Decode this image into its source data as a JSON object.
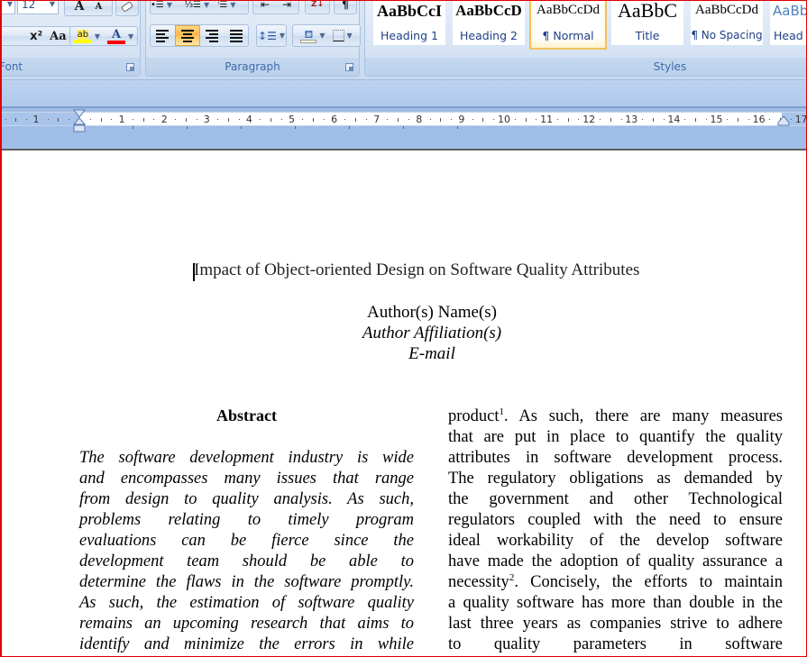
{
  "ribbon": {
    "font_group": {
      "label": "Font",
      "font_size": "12",
      "grow_font_label": "A",
      "shrink_font_label": "A",
      "superscript_label": "x²",
      "change_case_label": "Aa",
      "highlight_label": "ab",
      "font_color_label": "A",
      "highlight_color": "#ffff00",
      "font_color": "#ff0000"
    },
    "paragraph_group": {
      "label": "Paragraph",
      "active_alignment": "center",
      "sort_label": "A Z",
      "show_marks_label": "¶"
    },
    "styles_group": {
      "label": "Styles",
      "styles": [
        {
          "sample": "AaBbCcI",
          "name": "Heading 1",
          "selected": false
        },
        {
          "sample": "AaBbCcD",
          "name": "Heading 2",
          "selected": false
        },
        {
          "sample": "AaBbCcDd",
          "name": "¶ Normal",
          "selected": true
        },
        {
          "sample": "AaBbC",
          "name": "Title",
          "selected": false
        },
        {
          "sample": "AaBbCcDd",
          "name": "¶ No Spacing",
          "selected": false
        },
        {
          "sample": "AaBb",
          "name": "Head",
          "selected": false
        }
      ]
    }
  },
  "ruler": {
    "left_numbers": [
      "1"
    ],
    "numbers": [
      "1",
      "2",
      "3",
      "4",
      "5",
      "6",
      "7",
      "8",
      "9",
      "10",
      "11",
      "12",
      "13",
      "14",
      "15",
      "16",
      "17"
    ]
  },
  "document": {
    "title": "Impact of Object-oriented Design on Software Quality Attributes",
    "author_name": "Author(s) Name(s)",
    "author_affiliation": "Author Affiliation(s)",
    "email": "E-mail",
    "abstract_heading": "Abstract",
    "abstract_lines": [
      "The software development industry is wide",
      "and encompasses many issues that range",
      "from design to quality analysis. As such,",
      "problems relating to timely program",
      "evaluations can be fierce since the",
      "development team should be able to",
      "determine the flaws in the software promptly.",
      "As such, the estimation of software quality",
      "remains an upcoming research that aims to",
      "identify and minimize the errors in while"
    ],
    "right_column": {
      "line1_a": "product",
      "footnote1": "1",
      "line1_b": ". As such, there are many measures",
      "lines_mid": [
        "that are put in place to quantify the quality",
        "attributes in software development process.",
        "The regulatory obligations as demanded by",
        "the government and other Technological",
        "regulators coupled with the need to ensure",
        "ideal workability of the develop software",
        "have made the adoption of quality assurance a"
      ],
      "line9_a": "necessity",
      "footnote2": "2",
      "line9_b": ". Concisely, the efforts to maintain",
      "lines_end": [
        "a quality software has more than double in the",
        "last three years as companies strive to adhere",
        "to quality parameters in software"
      ]
    }
  }
}
